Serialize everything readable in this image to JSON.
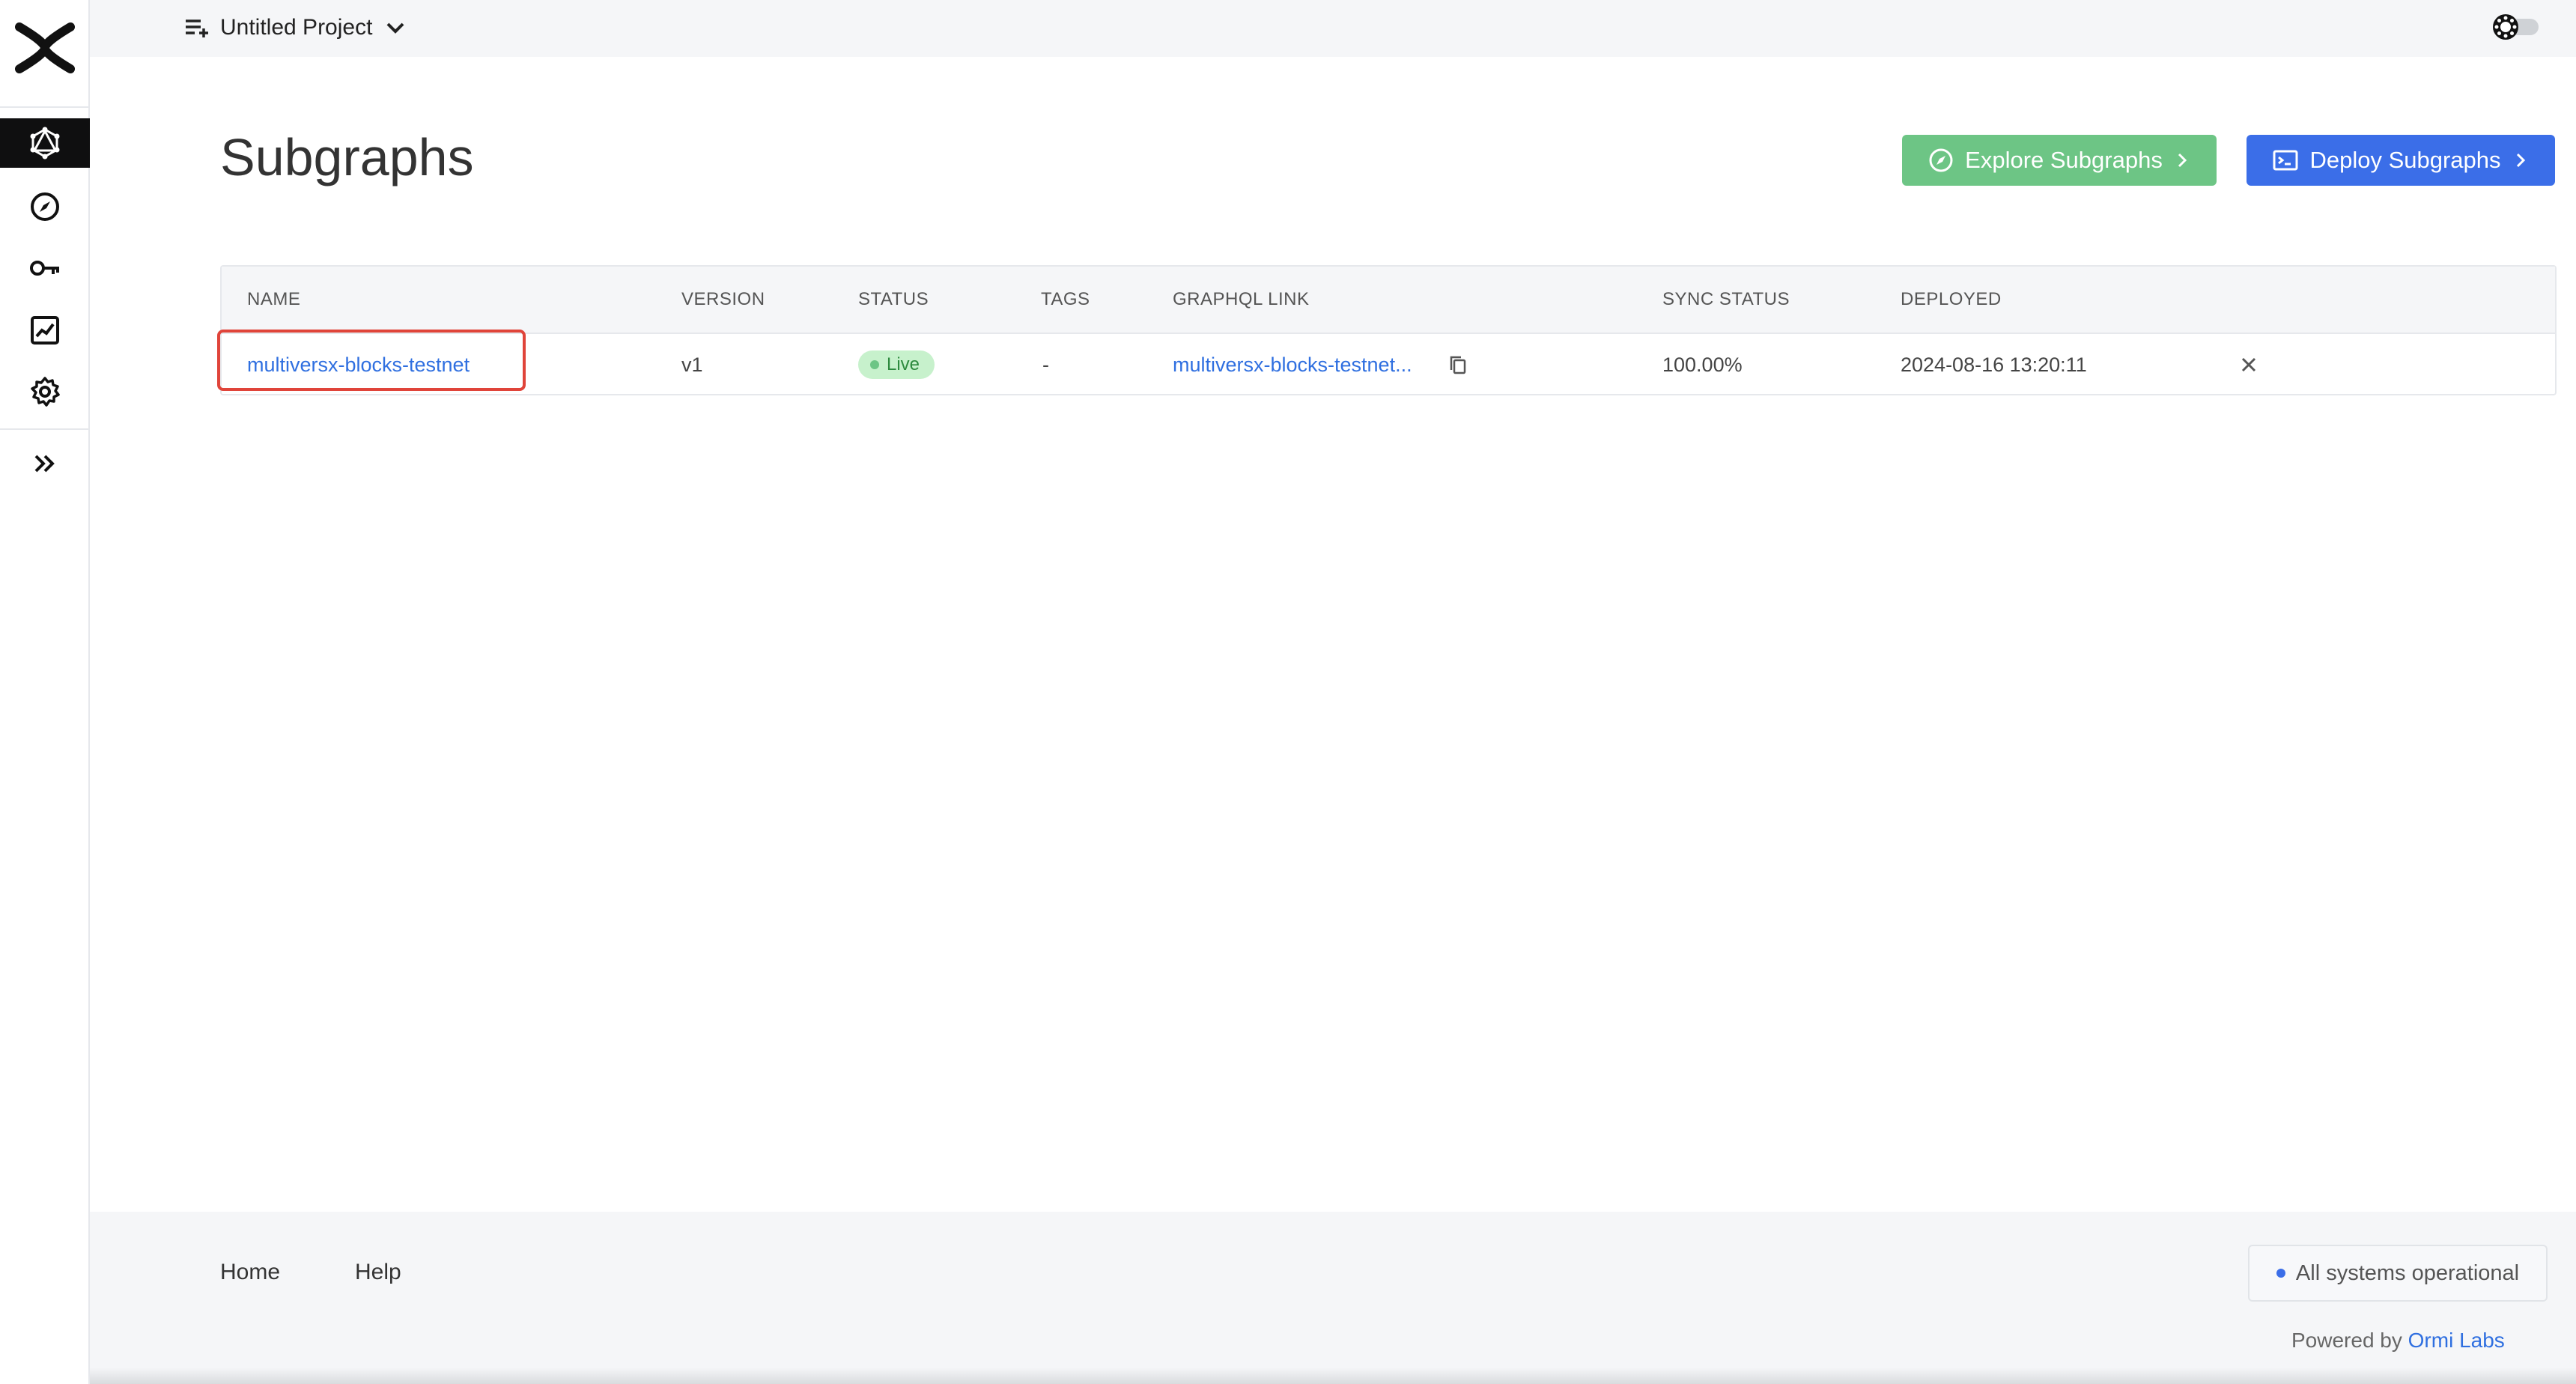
{
  "topbar": {
    "project_name": "Untitled Project"
  },
  "sidebar": {
    "items": [
      {
        "name": "subgraphs",
        "icon": "graphql-icon",
        "active": true
      },
      {
        "name": "explore",
        "icon": "compass-icon"
      },
      {
        "name": "api-keys",
        "icon": "key-icon"
      },
      {
        "name": "analytics",
        "icon": "chart-icon"
      },
      {
        "name": "settings",
        "icon": "gear-icon"
      }
    ],
    "expand_icon": "double-chevron-right-icon"
  },
  "main": {
    "title": "Subgraphs",
    "explore_button": "Explore Subgraphs",
    "deploy_button": "Deploy Subgraphs"
  },
  "table": {
    "headers": {
      "name": "NAME",
      "version": "VERSION",
      "status": "STATUS",
      "tags": "TAGS",
      "graphql_link": "GRAPHQL LINK",
      "sync_status": "SYNC STATUS",
      "deployed": "DEPLOYED"
    },
    "rows": [
      {
        "name": "multiversx-blocks-testnet",
        "version": "v1",
        "status": "Live",
        "tags": "-",
        "graphql_link": "multiversx-blocks-testnet...",
        "sync_status": "100.00%",
        "deployed": "2024-08-16 13:20:11"
      }
    ]
  },
  "footer": {
    "home": "Home",
    "help": "Help",
    "system_status": "All systems operational",
    "powered_by": "Powered by",
    "brand": "Ormi Labs"
  },
  "colors": {
    "accent_blue": "#3b6ee8",
    "explore_green": "#6dc585",
    "live_badge_bg": "#c7f1cc",
    "highlight_red": "#e0443a"
  }
}
